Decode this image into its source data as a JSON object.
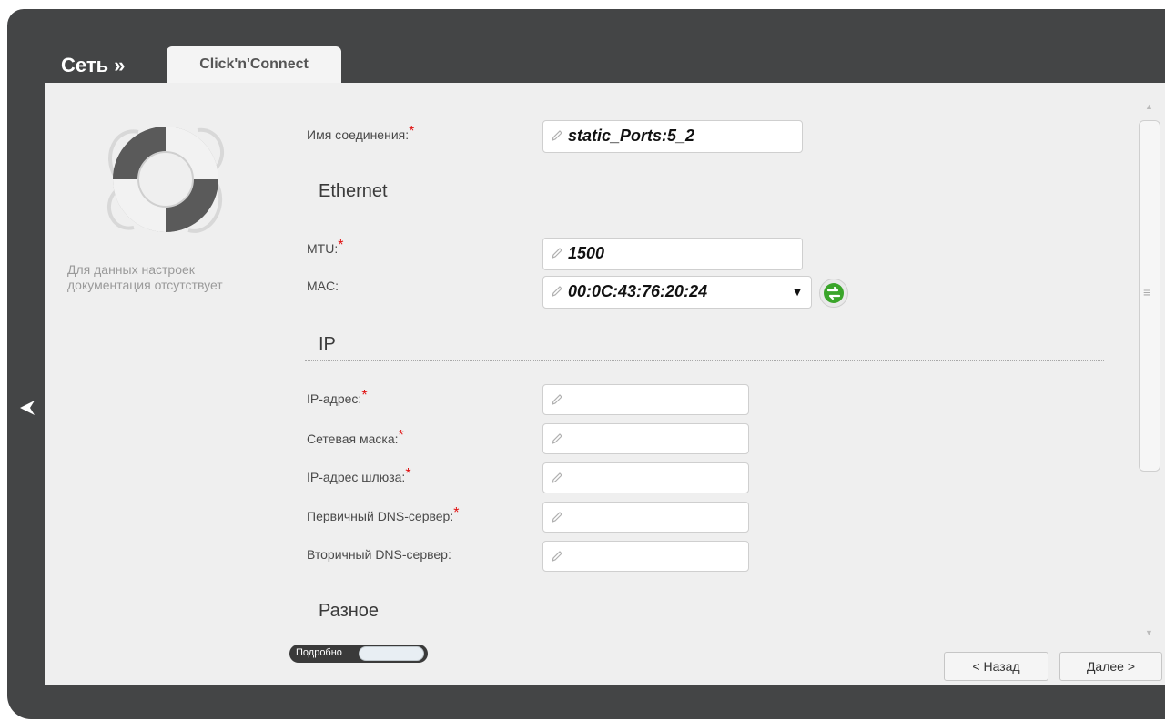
{
  "header": {
    "breadcrumb": "Сеть »",
    "tab_label": "Click'n'Connect"
  },
  "sidebar": {
    "help_icon": "lifebuoy-icon",
    "help_text": "Для данных настроек документация отсутствует"
  },
  "form": {
    "connection_name": {
      "label": "Имя соединения:",
      "required": "*",
      "value": "static_Ports:5_2"
    },
    "ethernet_section": "Ethernet",
    "mtu": {
      "label": "MTU:",
      "required": "*",
      "value": "1500"
    },
    "mac": {
      "label": "MAC:",
      "value": "00:0C:43:76:20:24"
    },
    "ip_section": "IP",
    "ip_address": {
      "label": "IP-адрес:",
      "required": "*",
      "value": ""
    },
    "netmask": {
      "label": "Сетевая маска:",
      "required": "*",
      "value": ""
    },
    "gateway": {
      "label": "IP-адрес шлюза:",
      "required": "*",
      "value": ""
    },
    "primary_dns": {
      "label": "Первичный DNS-сервер:",
      "required": "*",
      "value": ""
    },
    "secondary_dns": {
      "label": "Вторичный DNS-сервер:",
      "value": ""
    },
    "misc_section": "Разное"
  },
  "footer": {
    "details_toggle_label": "Подробно",
    "back_button": "< Назад",
    "next_button": "Далее >"
  },
  "colors": {
    "frame": "#444546",
    "panel": "#efefef",
    "required": "#e01010",
    "refresh_green": "#3aa52a"
  }
}
